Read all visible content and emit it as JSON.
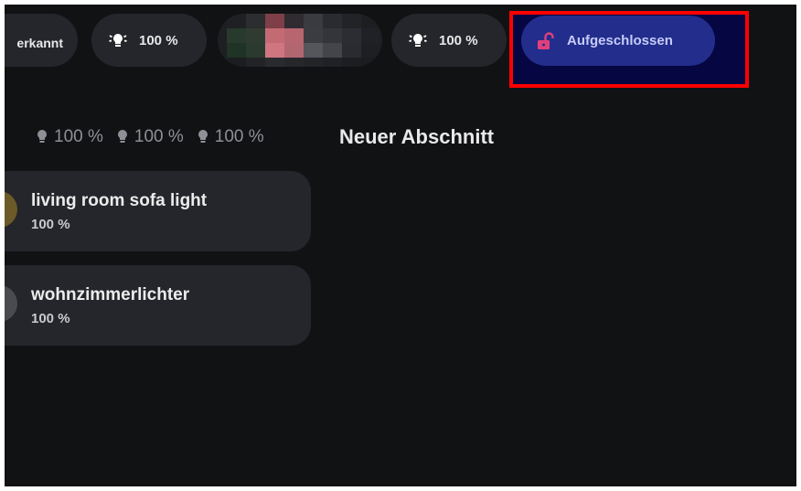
{
  "chips": {
    "partial_label": "erkannt",
    "light1_value": "100 %",
    "light2_value": "100 %",
    "lock_label": "Aufgeschlossen"
  },
  "status_row": [
    {
      "value": "100 %",
      "icon": "bulb-icon"
    },
    {
      "value": "100 %",
      "icon": "bulb-icon"
    },
    {
      "value": "100 %",
      "icon": "bulb-icon"
    }
  ],
  "section": {
    "title": "Neuer Abschnitt"
  },
  "cards": [
    {
      "name": "living room sofa light",
      "state": "100 %"
    },
    {
      "name": "wohnzimmerlichter",
      "state": "100 %"
    }
  ],
  "colors": {
    "background": "#111214",
    "card": "#25262b",
    "lock_accent": "#e0407a",
    "highlight_border": "#ff0000"
  }
}
